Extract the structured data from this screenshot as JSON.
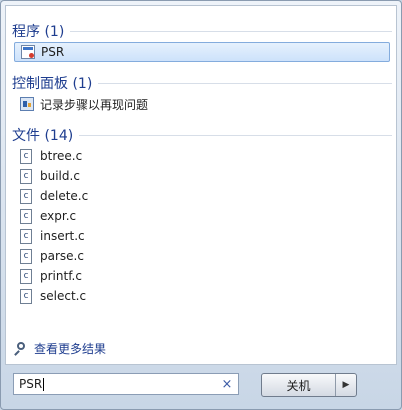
{
  "groups": {
    "programs": {
      "header": "程序 (1)",
      "items": [
        {
          "label": "PSR",
          "icon": "app-window-icon"
        }
      ]
    },
    "control_panel": {
      "header": "控制面板 (1)",
      "items": [
        {
          "label": "记录步骤以再现问题",
          "icon": "control-panel-icon"
        }
      ]
    },
    "files": {
      "header": "文件 (14)",
      "items": [
        {
          "label": "btree.c"
        },
        {
          "label": "build.c"
        },
        {
          "label": "delete.c"
        },
        {
          "label": "expr.c"
        },
        {
          "label": "insert.c"
        },
        {
          "label": "parse.c"
        },
        {
          "label": "printf.c"
        },
        {
          "label": "select.c"
        }
      ],
      "file_icon_glyph": "c"
    }
  },
  "see_more": {
    "label": "查看更多结果",
    "icon": "magnifier-icon"
  },
  "search": {
    "value": "PSR",
    "clear_glyph": "×"
  },
  "shutdown": {
    "label": "关机",
    "arrow": "▶"
  }
}
